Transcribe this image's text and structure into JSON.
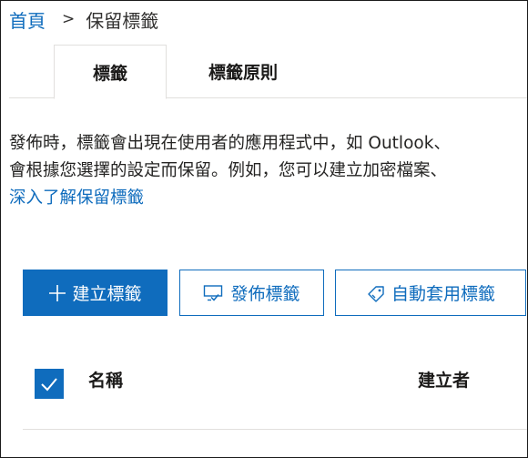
{
  "breadcrumb": {
    "home": "首頁",
    "separator": ">",
    "current": "保留標籤"
  },
  "tabs": [
    {
      "label": "標籤",
      "selected": true
    },
    {
      "label": "標籤原則",
      "selected": false
    }
  ],
  "description": {
    "line1": "發佈時，標籤會出現在使用者的應用程式中，如 Outlook、",
    "line2": "會根據您選擇的設定而保留。例如，您可以建立加密檔案、",
    "learn_more": "深入了解保留標籤"
  },
  "toolbar": {
    "create_label": "建立標籤",
    "publish_label": "發佈標籤",
    "auto_apply_label": "自動套用標籤",
    "icons": {
      "create": "plus-icon",
      "publish": "publish-icon",
      "auto_apply": "tag-icon"
    }
  },
  "table": {
    "select_all_checked": true,
    "columns": [
      "名稱",
      "建立者"
    ]
  },
  "colors": {
    "accent": "#0f6cbd",
    "text": "#252423",
    "divider": "#e1dfdd"
  }
}
